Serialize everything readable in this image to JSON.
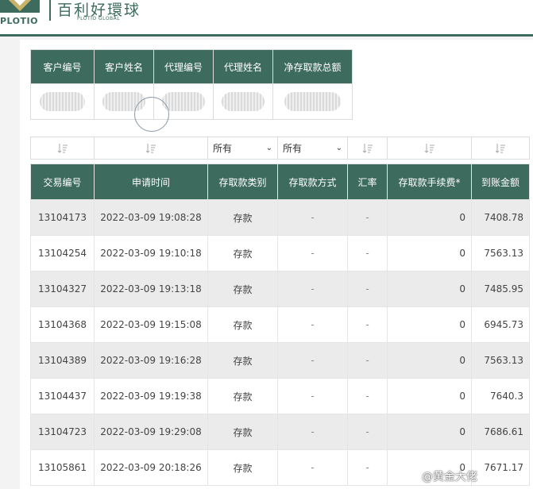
{
  "header": {
    "logo_en": "PLOTIO",
    "logo_cn": "百利好環球",
    "logo_sub": "PLOTIO GLOBAL",
    "brand_color": "#3d6b5e",
    "accent_color": "#c9b36a"
  },
  "summary": {
    "columns": [
      "客户编号",
      "客户姓名",
      "代理编号",
      "代理姓名",
      "净存取款总额"
    ]
  },
  "filters": {
    "type_select": "所有",
    "method_select": "所有"
  },
  "table": {
    "columns": [
      "交易编号",
      "申请时间",
      "存取款类别",
      "存取款方式",
      "汇率",
      "存取款手续费*",
      "到账金额"
    ],
    "rows": [
      {
        "id": "13104173",
        "time": "2022-03-09 19:08:28",
        "category": "存款",
        "method": "-",
        "rate": "-",
        "fee": "0",
        "amount": "7408.78"
      },
      {
        "id": "13104254",
        "time": "2022-03-09 19:10:18",
        "category": "存款",
        "method": "-",
        "rate": "-",
        "fee": "0",
        "amount": "7563.13"
      },
      {
        "id": "13104327",
        "time": "2022-03-09 19:13:18",
        "category": "存款",
        "method": "-",
        "rate": "-",
        "fee": "0",
        "amount": "7485.95"
      },
      {
        "id": "13104368",
        "time": "2022-03-09 19:15:08",
        "category": "存款",
        "method": "-",
        "rate": "-",
        "fee": "0",
        "amount": "6945.73"
      },
      {
        "id": "13104389",
        "time": "2022-03-09 19:16:28",
        "category": "存款",
        "method": "-",
        "rate": "-",
        "fee": "0",
        "amount": "7563.13"
      },
      {
        "id": "13104437",
        "time": "2022-03-09 19:19:38",
        "category": "存款",
        "method": "-",
        "rate": "-",
        "fee": "0",
        "amount": "7640.3"
      },
      {
        "id": "13104723",
        "time": "2022-03-09 19:29:08",
        "category": "存款",
        "method": "-",
        "rate": "-",
        "fee": "0",
        "amount": "7686.61"
      },
      {
        "id": "13105861",
        "time": "2022-03-09 20:18:26",
        "category": "存款",
        "method": "-",
        "rate": "-",
        "fee": "0",
        "amount": "7671.17"
      }
    ]
  },
  "watermark": "@黄金大佬"
}
